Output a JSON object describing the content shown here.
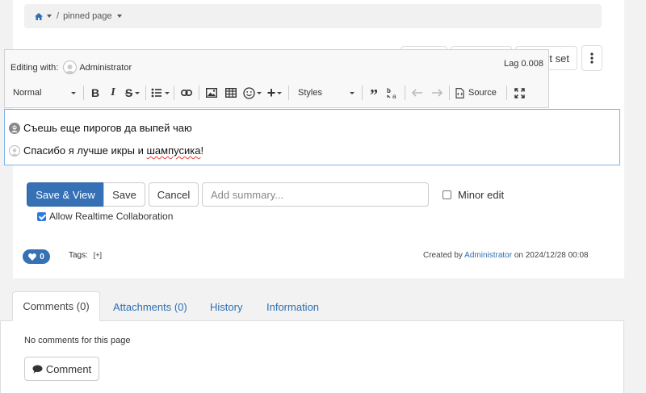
{
  "breadcrumb": {
    "current": "pinned page"
  },
  "obscured_toolbar": {
    "set_label": "t set"
  },
  "editor": {
    "editing_with_label": "Editing with:",
    "user": "Administrator",
    "lag": "Lag 0.008",
    "format_select": "Normal",
    "styles_select": "Styles",
    "source_label": "Source",
    "lines": [
      "Съешь еще пирогов да выпей чаю",
      "Спасибо я лучше икры и ",
      "шампусика",
      "!"
    ]
  },
  "actions": {
    "save_view": "Save & View",
    "save": "Save",
    "cancel": "Cancel",
    "summary_placeholder": "Add summary...",
    "minor_edit": "Minor edit",
    "minor_edit_checked": false,
    "realtime": "Allow Realtime Collaboration",
    "realtime_checked": true
  },
  "meta": {
    "likes": "0",
    "tags_label": "Tags:",
    "tags_add": "[+]",
    "created_prefix": "Created by",
    "created_user": "Administrator",
    "created_on": "on 2024/12/28 00:08"
  },
  "tabs": {
    "comments": "Comments (0)",
    "attachments": "Attachments (0)",
    "history": "History",
    "information": "Information"
  },
  "comments": {
    "empty_text": "No comments for this page",
    "button": "Comment"
  },
  "colors": {
    "primary": "#3670b5",
    "link": "#2c6fb3",
    "editor_border": "#7fb0e6"
  }
}
